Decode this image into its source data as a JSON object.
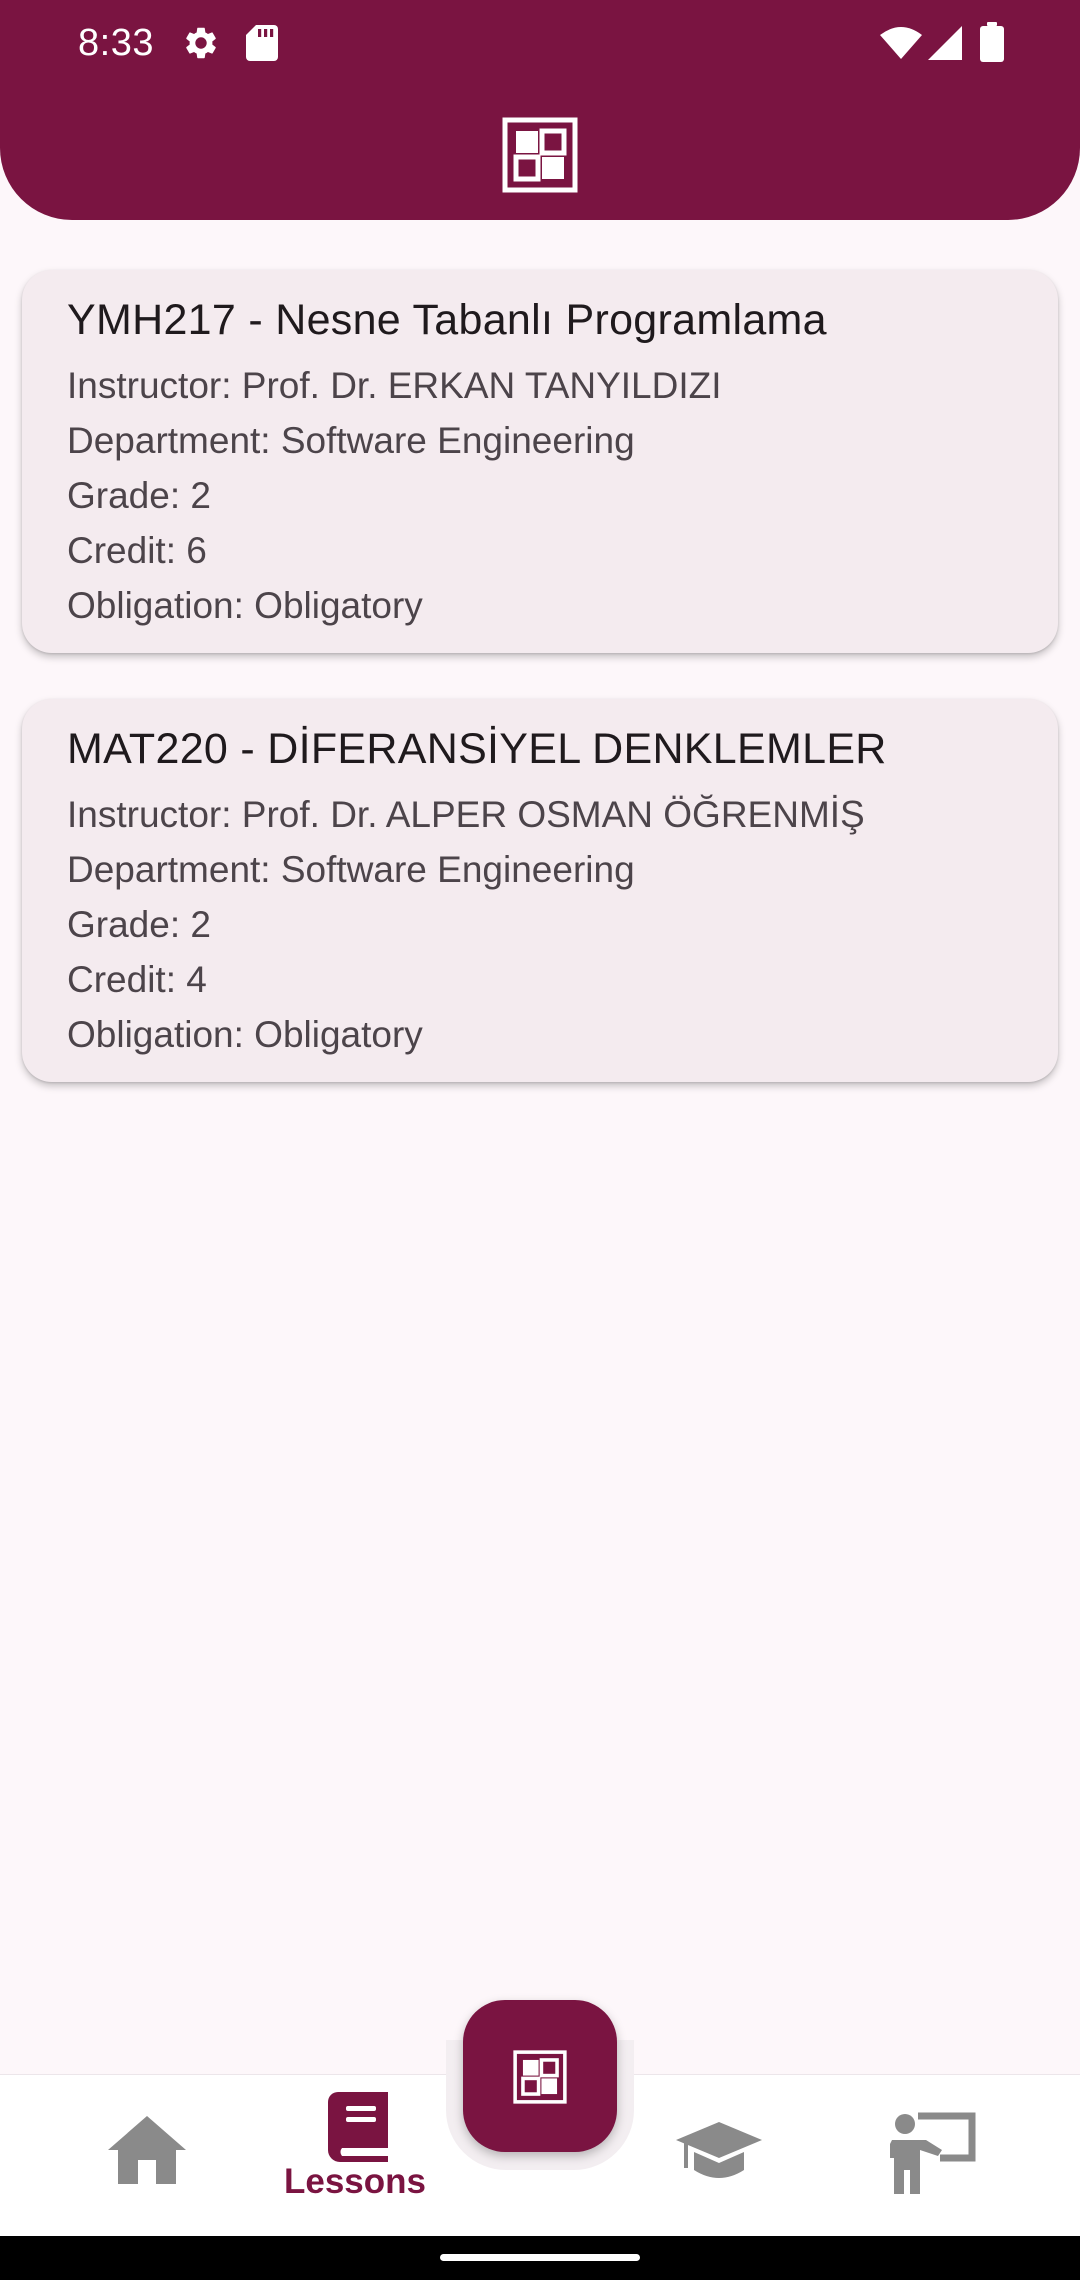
{
  "status_bar": {
    "time": "8:33",
    "left_icons": [
      "gear-icon",
      "sd-card-icon"
    ],
    "right_icons": [
      "wifi-icon",
      "signal-icon",
      "battery-icon"
    ]
  },
  "header": {
    "logo": "app-logo-icon"
  },
  "lessons": [
    {
      "title": "YMH217 - Nesne Tabanlı Programlama",
      "instructor": "Instructor: Prof. Dr. ERKAN TANYILDIZI",
      "department": "Department: Software Engineering",
      "grade": "Grade: 2",
      "credit": "Credit: 6",
      "obligation": "Obligation: Obligatory"
    },
    {
      "title": "MAT220 - DİFERANSİYEL DENKLEMLER",
      "instructor": "Instructor: Prof. Dr. ALPER OSMAN ÖĞRENMİŞ",
      "department": "Department: Software Engineering",
      "grade": "Grade: 2",
      "credit": "Credit: 4",
      "obligation": "Obligation: Obligatory"
    }
  ],
  "bottom_nav": {
    "items": [
      {
        "icon": "home-icon",
        "label": ""
      },
      {
        "icon": "book-icon",
        "label": "Lessons",
        "active": true
      },
      {
        "icon": "graduation-cap-icon",
        "label": ""
      },
      {
        "icon": "teacher-icon",
        "label": ""
      }
    ],
    "fab_icon": "app-logo-icon"
  },
  "colors": {
    "primary": "#7A1441",
    "background": "#FDF7FA",
    "card": "#F4EBEF",
    "inactive_icon": "#8A8A8A"
  }
}
